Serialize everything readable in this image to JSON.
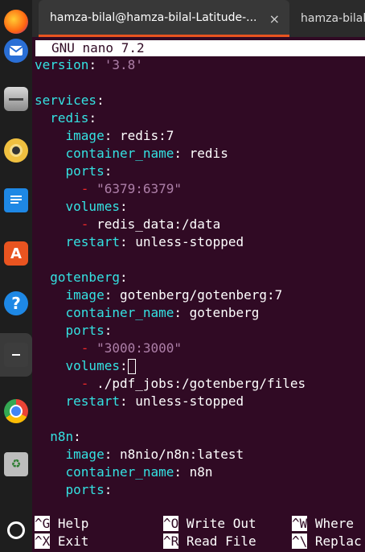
{
  "tabs": [
    {
      "title": "hamza-bilal@hamza-bilal-Latitude-...",
      "close": "×"
    },
    {
      "title": "hamza-bilal@"
    }
  ],
  "nano": {
    "title": "GNU nano 7.2"
  },
  "file": {
    "line1": {
      "key": "version",
      "value": "'3.8'"
    },
    "line3": {
      "key": "services"
    },
    "redis": {
      "name": "redis",
      "image_key": "image",
      "image": "redis:7",
      "cname_key": "container_name",
      "cname": "redis",
      "ports_key": "ports",
      "port": "\"6379:6379\"",
      "volumes_key": "volumes",
      "volume": "redis_data:/data",
      "restart_key": "restart",
      "restart": "unless-stopped"
    },
    "gotenberg": {
      "name": "gotenberg",
      "image_key": "image",
      "image": "gotenberg/gotenberg:7",
      "cname_key": "container_name",
      "cname": "gotenberg",
      "ports_key": "ports",
      "port": "\"3000:3000\"",
      "volumes_key": "volumes",
      "volume": "./pdf_jobs:/gotenberg/files",
      "restart_key": "restart",
      "restart": "unless-stopped"
    },
    "n8n": {
      "name": "n8n",
      "image_key": "image",
      "image": "n8nio/n8n:latest",
      "cname_key": "container_name",
      "cname": "n8n",
      "ports_key": "ports"
    }
  },
  "shortcuts": [
    {
      "key": "^G",
      "label": " Help"
    },
    {
      "key": "^O",
      "label": " Write Out"
    },
    {
      "key": "^W",
      "label": " Where"
    },
    {
      "key": "^X",
      "label": " Exit"
    },
    {
      "key": "^R",
      "label": " Read File"
    },
    {
      "key": "^\\",
      "label": " Replac"
    }
  ],
  "dock": [
    {
      "name": "thunderbird-icon",
      "color": "#2a6fd6"
    },
    {
      "name": "files-icon",
      "color": "#7a7a7a"
    },
    {
      "name": "rhythmbox-icon",
      "color": "#e8b23c"
    },
    {
      "name": "writer-icon",
      "color": "#1e88e5"
    },
    {
      "name": "app-center-icon",
      "color": "#e95420"
    },
    {
      "name": "help-icon",
      "color": "#1e88e5"
    },
    {
      "name": "terminal-icon",
      "color": "#444444"
    },
    {
      "name": "chrome-icon",
      "color": "#4caf50"
    },
    {
      "name": "trash-icon",
      "color": "#9e9e9e"
    },
    {
      "name": "ubuntu-icon",
      "color": "#ffffff"
    }
  ]
}
